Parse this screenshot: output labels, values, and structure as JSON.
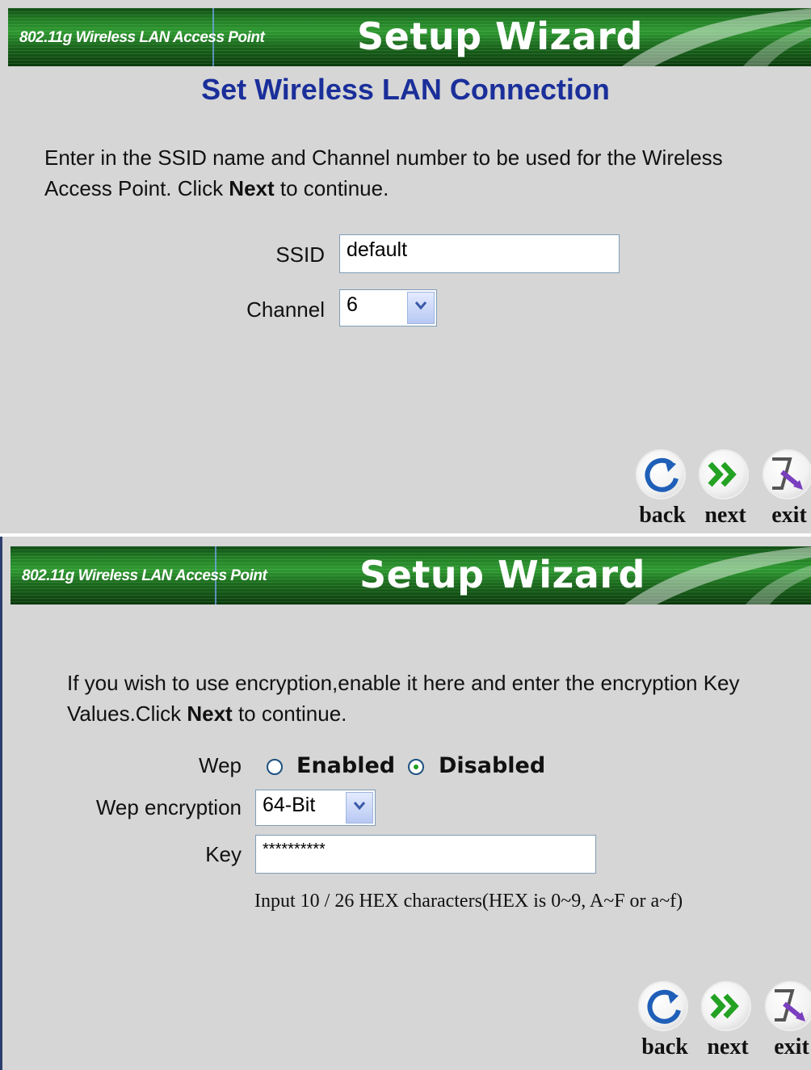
{
  "wizard1": {
    "brand_subtitle": "802.11g Wireless LAN Access Point",
    "brand_title": "Setup Wizard",
    "heading": "Set Wireless LAN Connection",
    "instruction_pre": "Enter in the SSID name and Channel number to be used for the Wireless Access Point. Click ",
    "instruction_bold": "Next",
    "instruction_post": " to continue.",
    "ssid_label": "SSID",
    "ssid_value": "default",
    "channel_label": "Channel",
    "channel_value": "6",
    "back_label": "back",
    "next_label": "next",
    "exit_label": "exit"
  },
  "wizard2": {
    "brand_subtitle": "802.11g Wireless LAN Access Point",
    "brand_title": "Setup Wizard",
    "instruction_pre": "If you wish to use encryption,enable it here and enter the encryption Key Values.Click ",
    "instruction_bold": "Next",
    "instruction_post": " to continue.",
    "wep_label": "Wep",
    "wep_enabled_label": "Enabled",
    "wep_disabled_label": "Disabled",
    "wep_selected": "Disabled",
    "wep_encryption_label": "Wep encryption",
    "wep_encryption_value": "64-Bit",
    "key_label": "Key",
    "key_value": "**********",
    "key_hint": "Input 10 / 26 HEX characters(HEX is 0~9, A~F or a~f)",
    "back_label": "back",
    "next_label": "next",
    "exit_label": "exit"
  },
  "colors": {
    "heading": "#1a2f9a",
    "banner_green": "#1f7a22",
    "panel_bg": "#d6d6d6"
  },
  "icons": {
    "back": "back-circular-arrow-icon",
    "next": "next-double-chevron-icon",
    "exit": "exit-door-arrow-icon",
    "dropdown": "chevron-down-icon"
  }
}
